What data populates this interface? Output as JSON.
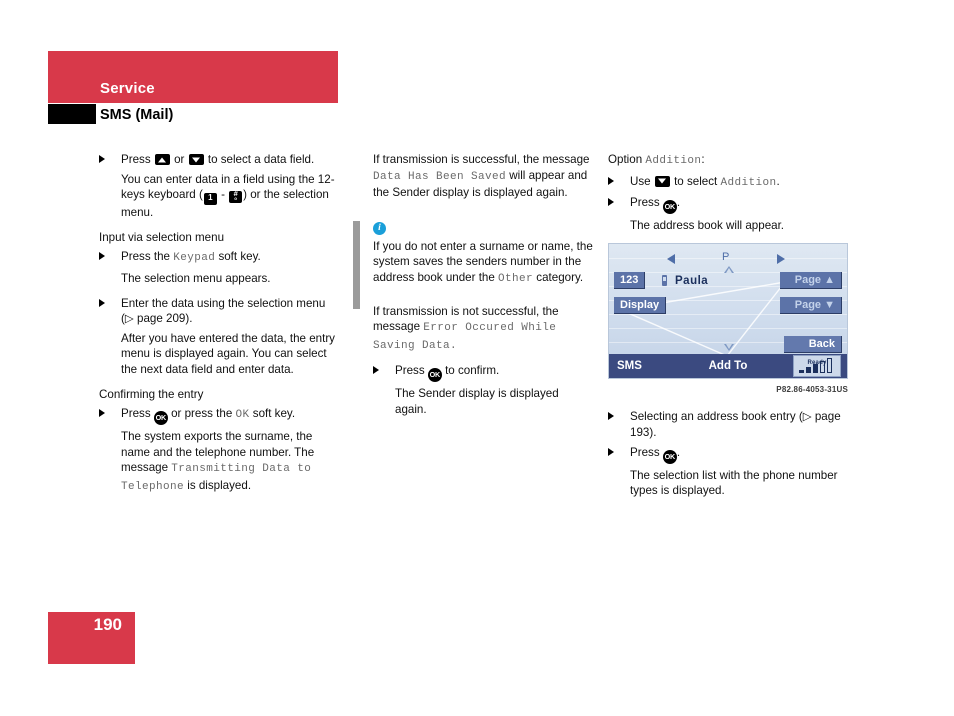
{
  "header": {
    "section": "Service",
    "page_title": "SMS (Mail)"
  },
  "footer": {
    "page_number": "190"
  },
  "columns": {
    "left": {
      "b1_pre": "Press ",
      "b1_mid": " or ",
      "b1_post": " to select a data field.",
      "b1_body_pre": "You can enter data in a field using the 12-keys keyboard (",
      "b1_body_mid": " - ",
      "b1_body_post": ") or the selection menu.",
      "h1": "Input via selection menu",
      "b2_pre": "Press the ",
      "b2_mono": "Keypad",
      "b2_post": " soft key.",
      "b2_body": "The selection menu appears.",
      "b3": "Enter the data using the selection menu (▷ page 209).",
      "b3_body": "After you have entered the data, the entry menu is displayed again. You can select the next data field and enter data.",
      "h2": "Confirming the entry",
      "b4_pre": "Press ",
      "b4_mid": " or press the ",
      "b4_mono": "OK",
      "b4_post": " soft key.",
      "b4_body_pre": "The system exports the surname, the name and the telephone number. The message ",
      "b4_body_mono": "Transmitting Data to Telephone",
      "b4_body_post": " is displayed."
    },
    "mid": {
      "p1_pre": "If transmission is successful, the message ",
      "p1_mono": "Data Has Been Saved",
      "p1_post": " will appear and the Sender display is displayed again.",
      "note_icon": "info-icon",
      "note_glyph": "i",
      "note_pre": "If you do not enter a surname or name, the system saves the senders number in the address book under the ",
      "note_mono": "Other",
      "note_post": " category.",
      "p2_pre": "If transmission is not successful, the message ",
      "p2_mono": "Error Occured While Saving Data",
      "p2_post": ".",
      "b1_pre": "Press ",
      "b1_post": " to confirm.",
      "b1_body": "The Sender display is displayed again."
    },
    "right": {
      "h1_pre": "Option ",
      "h1_mono": "Addition",
      "h1_post": ":",
      "b1_pre": "Use ",
      "b1_mid": " to select ",
      "b1_mono": "Addition",
      "b1_post": ".",
      "b2_pre": "Press ",
      "b2_post": ".",
      "b2_body": "The address book will appear.",
      "b3": "Selecting an address book entry (▷ page 193).",
      "b4_pre": "Press ",
      "b4_post": ".",
      "b4_body": "The selection list with the phone number types is displayed."
    }
  },
  "display": {
    "caption": "P82.86-4053-31US",
    "nav_left_icon": "triangle-left-icon",
    "nav_right_icon": "triangle-right-icon",
    "position_label": "P",
    "scroll_up_icon": "hollow-triangle-up-icon",
    "scroll_down_icon": "hollow-triangle-down-icon",
    "btn_123": "123",
    "btn_display": "Display",
    "entry_name": "Paula",
    "entry_icon": "mobile-phone-icon",
    "btn_page_up": "Page ▲",
    "btn_page_down": "Page ▼",
    "btn_back": "Back",
    "bar_left": "SMS",
    "bar_center": "Add To",
    "status_label": "Ready",
    "signal_bars": [
      3,
      2
    ],
    "colors": {
      "screen_bg": "#cfdced",
      "button_blue": "#5c73a8",
      "bar_blue": "#3b4a80",
      "text_navy": "#1b2f5c"
    }
  },
  "keys": {
    "up": "▲",
    "down": "▼",
    "one": "1",
    "hash": "#",
    "ok": "OK"
  },
  "colors": {
    "brand_red": "#d8394a",
    "note_bar_gray": "#9b9b9b",
    "info_blue": "#1a9fd9",
    "mono_gray": "#6a6a6a"
  }
}
